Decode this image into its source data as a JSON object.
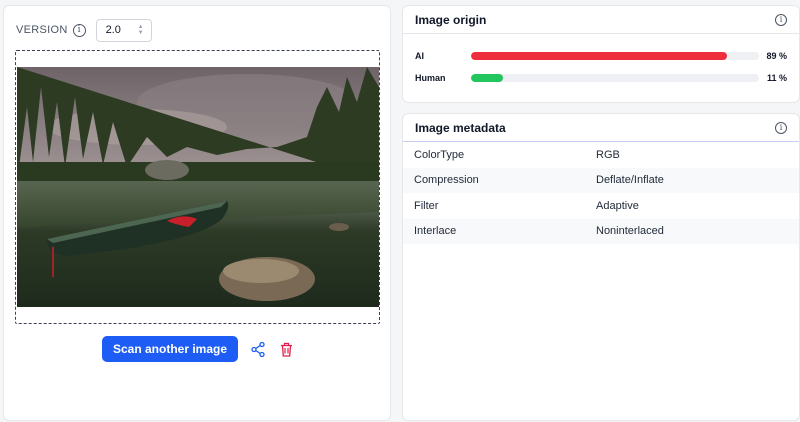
{
  "version": {
    "label": "VERSION",
    "value": "2.0"
  },
  "actions": {
    "scan_label": "Scan another image"
  },
  "origin": {
    "title": "Image origin",
    "rows": [
      {
        "label": "AI",
        "percent_text": "89 %",
        "value": 0.89,
        "color": "#ef2e3b"
      },
      {
        "label": "Human",
        "percent_text": "11 %",
        "value": 0.11,
        "color": "#22c55e"
      }
    ]
  },
  "metadata": {
    "title": "Image metadata",
    "rows": [
      {
        "key": "ColorType",
        "value": "RGB"
      },
      {
        "key": "Compression",
        "value": "Deflate/Inflate"
      },
      {
        "key": "Filter",
        "value": "Adaptive"
      },
      {
        "key": "Interlace",
        "value": "Noninterlaced"
      }
    ]
  },
  "colors": {
    "accent": "#1d5cf5",
    "delete": "#e11d48"
  }
}
